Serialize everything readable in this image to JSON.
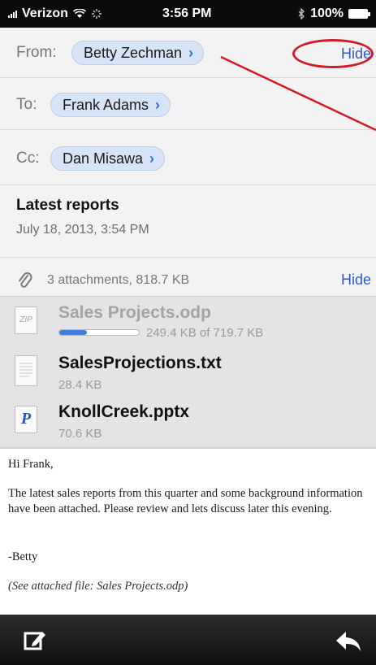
{
  "status_bar": {
    "carrier": "Verizon",
    "time": "3:56 PM",
    "battery": "100%",
    "icons": [
      "signal-icon",
      "wifi-icon",
      "activity-icon",
      "bluetooth-icon",
      "battery-icon"
    ]
  },
  "header": {
    "from_label": "From:",
    "from_name": "Betty Zechman",
    "hide_label": "Hide",
    "to_label": "To:",
    "to_name": "Frank Adams",
    "cc_label": "Cc:",
    "cc_name": "Dan Misawa",
    "subject": "Latest reports",
    "date": "July 18, 2013, 3:54 PM"
  },
  "attachments": {
    "summary": "3 attachments, 818.7 KB",
    "hide_label": "Hide",
    "items": [
      {
        "name": "Sales Projects.odp",
        "size": "249.4 KB of 719.7 KB",
        "icon": "odp-file-icon",
        "downloading": true,
        "progress": 0.35
      },
      {
        "name": "SalesProjections.txt",
        "size": "28.4 KB",
        "icon": "txt-file-icon"
      },
      {
        "name": "KnollCreek.pptx",
        "size": "70.6 KB",
        "icon": "pptx-file-icon"
      }
    ]
  },
  "body": {
    "greeting": "Hi Frank,",
    "paragraph": "The latest sales reports from this quarter and some background information have been attached. Please review and lets discuss later this evening.",
    "signature": "-Betty",
    "attachment_note": "(See attached file: Sales Projects.odp)"
  },
  "toolbar": {
    "icons": [
      "compose-icon",
      "reply-icon"
    ]
  },
  "colors": {
    "link_blue": "#2f59c6",
    "pill_bg": "#d7e3f6",
    "annotation_red": "#d31a25",
    "toolbar_bg": "#1a1a1a"
  }
}
